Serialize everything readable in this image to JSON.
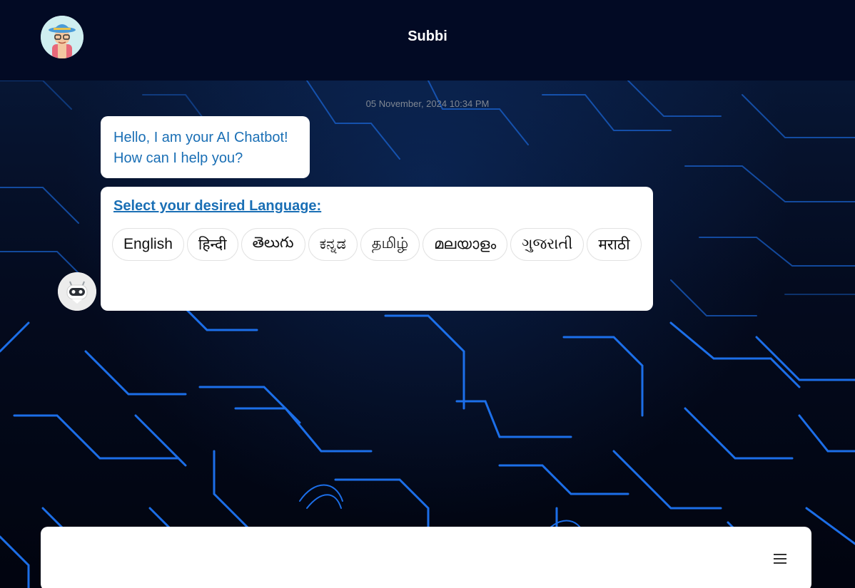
{
  "header": {
    "title": "Subbi",
    "avatar_icon": "user-avatar-icon"
  },
  "chat": {
    "timestamp": "05 November, 2024 10:34 PM",
    "greeting": {
      "line1": "Hello, I am your AI Chatbot!",
      "line2": "How can I help you?"
    },
    "language_prompt": "Select your desired Language:",
    "languages": [
      "English",
      "हिन्दी",
      "తెలుగు",
      "ಕನ್ನಡ",
      "தமிழ்",
      "മലയാളം",
      "ગુજરાતી",
      "मराठी"
    ],
    "bot_avatar_icon": "bot-avatar-icon"
  },
  "composer": {
    "placeholder": "",
    "menu_icon": "menu-icon"
  },
  "colors": {
    "header_bg": "#020a24",
    "accent_text": "#1a6fb5",
    "circuit": "#1f7aff"
  }
}
